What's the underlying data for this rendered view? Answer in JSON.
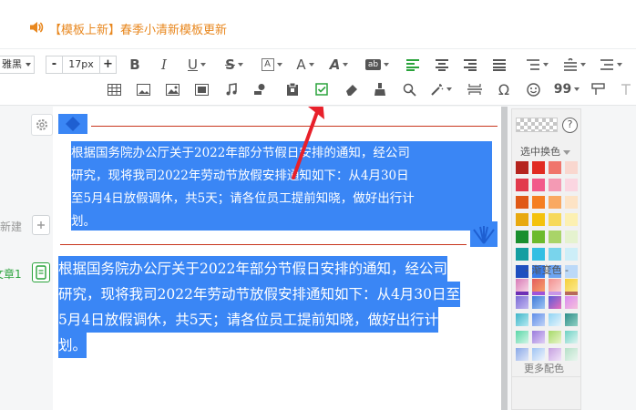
{
  "notice": {
    "text": "【模板上新】春季小清新模板更新",
    "color": "#e8871e"
  },
  "toolbar": {
    "font_family": "雅黑",
    "font_size": "17px",
    "minus_label": "-",
    "plus_label": "+",
    "buttons": [
      "bold-icon",
      "italic-icon",
      "underline-icon",
      "strikethrough-icon",
      "border-text-icon",
      "font-color-icon",
      "font-style-icon",
      "highlight-icon",
      "align-left-icon",
      "align-center-icon",
      "align-right-icon",
      "align-justify-icon",
      "line-spacing-icon",
      "paragraph-spacing-icon",
      "indent-icon"
    ],
    "row2": [
      "table-icon",
      "image-icon",
      "gallery-icon",
      "video-icon",
      "music-icon",
      "map-pin-icon",
      "paste-icon",
      "checkbox-icon",
      "eraser-icon",
      "format-brush-icon",
      "select-icon",
      "magic-wand-icon",
      "divider-icon",
      "omega-icon",
      "emoji-icon",
      "quote-icon",
      "insert-icon",
      "undo-icon"
    ],
    "italic_label": "I",
    "bold_label": "B",
    "underline_label": "U",
    "strike_label": "S",
    "a_label": "A",
    "ab_label": "ab",
    "omega_label": "Ω",
    "quote_label": "99"
  },
  "sidebar": {
    "new_label": "新建",
    "article_label": "文章1"
  },
  "editor": {
    "template_lines": [
      "根据国务院办公厅关于2022年部分节假日安排的通知，经公司",
      "研究，现将我司2022年劳动节放假安排通知如下：从4月30日",
      "至5月4日放假调休，共5天；请各位员工提前知晓，做好出行计",
      "划。"
    ],
    "plain_lines": [
      "根据国务院办公厅关于2022年部分节假日安排的通知，经公司",
      "研究，现将我司2022年劳动节放假安排通知如下：从4月30日至",
      "5月4日放假调休，共5天；请各位员工提前知晓，做好出行计",
      "划。"
    ],
    "selection_color": "#3a86f5",
    "rule_color": "#c8371e"
  },
  "palette": {
    "title": "选中换色",
    "gradient_title": "- 渐变色 -",
    "more_label": "更多配色",
    "help_label": "?",
    "solid": [
      "#b5241e",
      "#e12b22",
      "#f0756c",
      "#f9d7cf",
      "#e23a4c",
      "#f25a8a",
      "#f49ab4",
      "#fbd6e1",
      "#e05916",
      "#f57e21",
      "#f9a961",
      "#fde3c5",
      "#e8a90e",
      "#f4c20d",
      "#f7d95a",
      "#fcf0b2",
      "#1a8f2e",
      "#6cba2d",
      "#a9d468",
      "#e5f2cf",
      "#149ea1",
      "#33bfe3",
      "#79d4ec",
      "#cdeef8",
      "#1f4fbf",
      "#3a7ce8",
      "#6ea5f2",
      "#bcd9f8",
      "#6d2fb5",
      "#a054d9",
      "#c896e8",
      "#b7695a"
    ],
    "gradients": [
      [
        "#d77ab7",
        "#f8d4e4"
      ],
      [
        "#e35c5c",
        "#f7a36c"
      ],
      [
        "#f2908f",
        "#fbcfcf"
      ],
      [
        "#f5cf3a",
        "#fbe98b"
      ],
      [
        "#7b6bd6",
        "#c3b8f0"
      ],
      [
        "#3f7ad9",
        "#9fc4f3"
      ],
      [
        "#5b5bd6",
        "#e96dbd"
      ],
      [
        "#d98cf0",
        "#f6c1dc"
      ],
      [
        "#3fb5c8",
        "#b5eaf2"
      ],
      [
        "#5f8de8",
        "#c0d3f7"
      ],
      [
        "#8fd3f4",
        "#e6f4fb"
      ],
      [
        "#2f8e8a",
        "#8fd0c3"
      ],
      [
        "#5bd6a8",
        "#d1f6e6"
      ],
      [
        "#9a7bdc",
        "#e0cff5"
      ],
      [
        "#a6d96a",
        "#e9f5c9"
      ],
      [
        "#6ed1c4",
        "#dff5f1"
      ],
      [
        "#8aa9e8",
        "#dfe7f8"
      ],
      [
        "#9fc4f3",
        "#f0f5fc"
      ],
      [
        "#c6a0e0",
        "#f1e4f9"
      ],
      [
        "#b6e0c8",
        "#eaf6ef"
      ]
    ]
  }
}
